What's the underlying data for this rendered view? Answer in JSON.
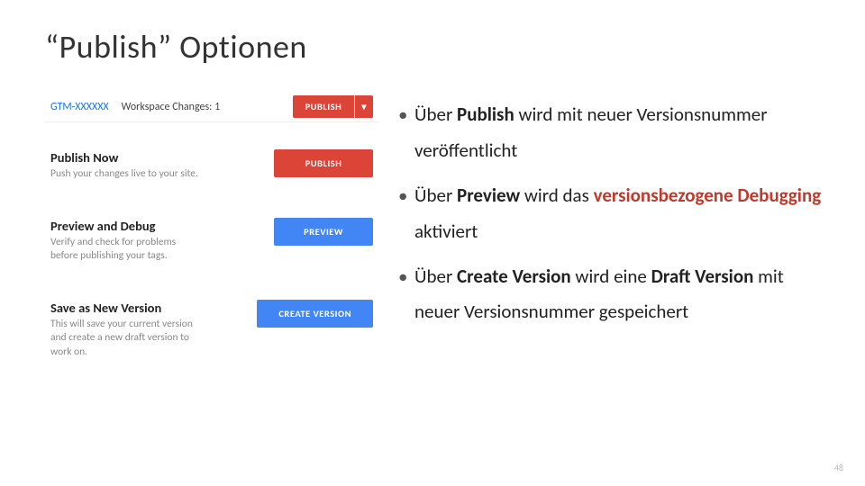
{
  "title": "“Publish” Optionen",
  "gtm": {
    "container_id": "GTM-XXXXXX",
    "workspace_changes_label": "Workspace Changes: 1",
    "top_publish_label": "PUBLISH",
    "dropdown_arrow": "▾",
    "options": [
      {
        "heading": "Publish Now",
        "desc": "Push your changes live to your site.",
        "button": "PUBLISH",
        "color": "red"
      },
      {
        "heading": "Preview and Debug",
        "desc": "Verify and check for problems before publishing your tags.",
        "button": "PREVIEW",
        "color": "blue"
      },
      {
        "heading": "Save as New Version",
        "desc": "This will save your current version and create a new draft version to work on.",
        "button": "CREATE VERSION",
        "color": "blue"
      }
    ]
  },
  "bullets": {
    "b1a": "Über ",
    "b1b": "Publish",
    "b1c": " wird mit neuer Versionsnummer veröffentlicht",
    "b2a": "Über ",
    "b2b": "Preview",
    "b2c": " wird das ",
    "b2d": "versionsbezogene Debugging",
    "b2e": " aktiviert",
    "b3a": "Über ",
    "b3b": "Create Version",
    "b3c": " wird eine ",
    "b3d": "Draft Version",
    "b3e": " mit neuer Versionsnummer gespeichert"
  },
  "dot": "•",
  "page_number": "48"
}
